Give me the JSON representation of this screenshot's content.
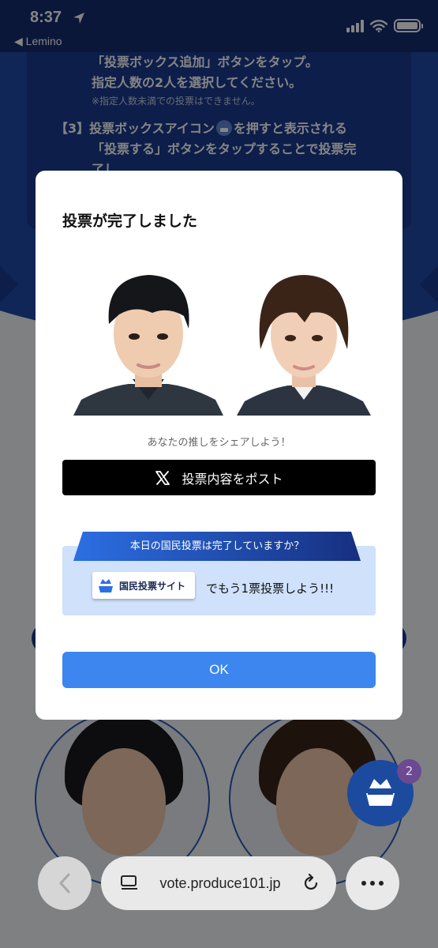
{
  "status_bar": {
    "time": "8:37",
    "back_app_label": "◀ Lemino"
  },
  "background_page": {
    "instructions": {
      "line1": "「投票ボックス追加」ボタンをタップ。",
      "line2": "指定人数の2人を選択してください。",
      "note": "※指定人数未満での投票はできません。",
      "step3_prefix": "【3】投票ボックスアイコン",
      "step3_suffix": "を押すと表示される",
      "step3_line2": "「投票する」ボタンをタップすることで投票完",
      "step3_line3": "了し"
    }
  },
  "vote_box": {
    "count": "2",
    "icon": "vote-box-crown-icon"
  },
  "modal": {
    "title": "投票が完了しました",
    "share_caption": "あなたの推しをシェアしよう！",
    "post_button": "投票内容をポスト",
    "post_icon": "x-logo-icon",
    "promo": {
      "ribbon_text": "本日の国民投票は完了していますか？",
      "site_button_label": "国民投票サイト",
      "text": "でもう1票投票しよう!!!"
    },
    "ok_button": "OK"
  },
  "browser": {
    "url": "vote.produce101.jp"
  },
  "colors": {
    "brand_navy": "#142c6e",
    "ok_blue": "#3d86ef",
    "promo_bg": "#cfe1fb",
    "ribbon_blue": "#1f4fb5"
  }
}
